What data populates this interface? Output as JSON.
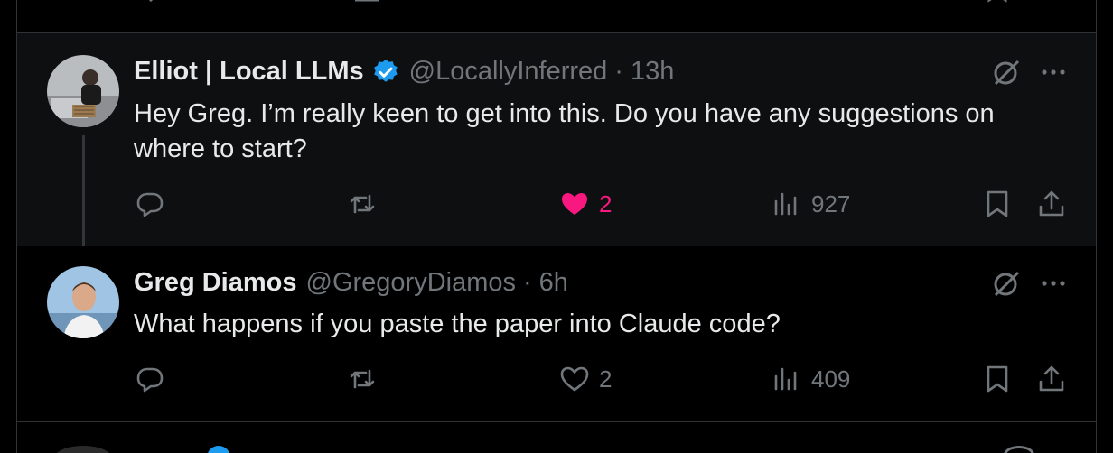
{
  "tweets": [
    {
      "display_name": "Elliot | Local LLMs",
      "handle": "@LocallyInferred",
      "time": "13h",
      "verified": true,
      "text": "Hey Greg. I’m really keen to get into this. Do you have any suggestions on where to start?",
      "likes": "2",
      "liked": true,
      "views": "927",
      "avatar_icon": "user-avatar-photo"
    },
    {
      "display_name": "Greg Diamos",
      "handle": "@GregoryDiamos",
      "time": "6h",
      "verified": false,
      "text": "What happens if you paste the paper into Claude code?",
      "likes": "2",
      "liked": false,
      "views": "409",
      "avatar_icon": "user-avatar-photo"
    }
  ],
  "separator": "·",
  "colors": {
    "background": "#000000",
    "text": "#e7e9ea",
    "muted": "#71767b",
    "like": "#f91880",
    "verified": "#1d9bf0",
    "border": "#2f3336"
  }
}
